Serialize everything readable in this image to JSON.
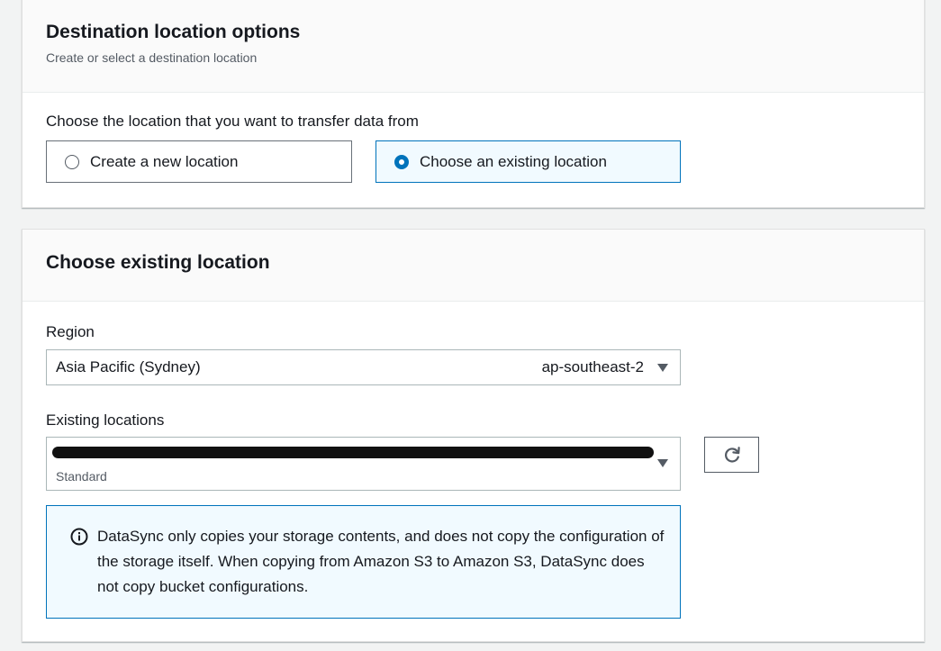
{
  "destination": {
    "title": "Destination location options",
    "description": "Create or select a destination location",
    "question": "Choose the location that you want to transfer data from",
    "options": [
      {
        "label": "Create a new location",
        "selected": false
      },
      {
        "label": "Choose an existing location",
        "selected": true
      }
    ]
  },
  "existing": {
    "title": "Choose existing location",
    "region": {
      "label": "Region",
      "value": "Asia Pacific (Sydney)",
      "code": "ap-southeast-2"
    },
    "locations": {
      "label": "Existing locations",
      "value_redacted": true,
      "sublabel": "Standard"
    },
    "info": "DataSync only copies your storage contents, and does not copy the configuration of the storage itself. When copying from Amazon S3 to Amazon S3, DataSync does not copy bucket configurations."
  },
  "icons": {
    "radio_unchecked": "radio-unchecked-icon",
    "radio_checked": "radio-checked-icon",
    "caret": "caret-down-icon",
    "refresh": "refresh-icon",
    "info": "info-icon"
  },
  "colors": {
    "accent": "#0073bb",
    "selected_bg": "#f1faff",
    "page_bg": "#f2f3f3"
  }
}
